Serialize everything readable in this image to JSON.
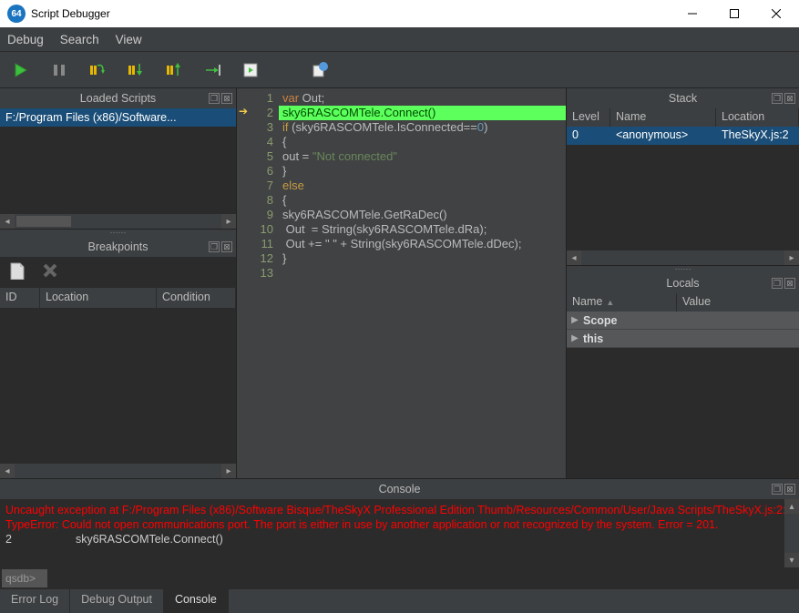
{
  "window": {
    "title": "Script Debugger",
    "icon_label": "64"
  },
  "menubar": [
    "Debug",
    "Search",
    "View"
  ],
  "toolbar": {
    "play": "play-icon",
    "pause": "pause-icon",
    "stepover": "step-over-icon",
    "stepinto": "step-into-icon",
    "stepout": "step-out-icon",
    "runcursor": "run-to-cursor-icon",
    "restart": "restart-icon",
    "module": "module-icon"
  },
  "loaded_scripts": {
    "title": "Loaded Scripts",
    "items": [
      "F:/Program Files (x86)/Software..."
    ]
  },
  "breakpoints": {
    "title": "Breakpoints",
    "headers": {
      "id": "ID",
      "location": "Location",
      "condition": "Condition"
    }
  },
  "editor": {
    "lines": [
      {
        "n": "1",
        "html": "<span class='kw'>var</span><span class='pl'> Out;</span>"
      },
      {
        "n": "2",
        "html": "<span class='hl-line'>sky6RASCOMTele.Connect()</span>"
      },
      {
        "n": "3",
        "html": "<span class='kw2'>if</span><span class='pl'> (sky6RASCOMTele.IsConnected==</span><span class='num'>0</span><span class='pl'>)</span>"
      },
      {
        "n": "4",
        "html": "<span class='pl'>{</span>"
      },
      {
        "n": "5",
        "html": "<span class='pl'>out = </span><span class='str'>\"Not connected\"</span>"
      },
      {
        "n": "6",
        "html": "<span class='pl'>}</span>"
      },
      {
        "n": "7",
        "html": "<span class='kw2'>else</span>"
      },
      {
        "n": "8",
        "html": "<span class='pl'>{</span>"
      },
      {
        "n": "9",
        "html": "<span class='pl'>sky6RASCOMTele.GetRaDec()</span>"
      },
      {
        "n": "10",
        "html": "<span class='pl'> Out  = String(sky6RASCOMTele.dRa);</span>"
      },
      {
        "n": "11",
        "html": "<span class='pl'> Out += \" \" + String(sky6RASCOMTele.dDec);</span>"
      },
      {
        "n": "12",
        "html": "<span class='pl'>}</span>"
      },
      {
        "n": "13",
        "html": ""
      }
    ],
    "current_line": 2
  },
  "stack": {
    "title": "Stack",
    "headers": {
      "level": "Level",
      "name": "Name",
      "location": "Location"
    },
    "rows": [
      {
        "level": "0",
        "name": "<anonymous>",
        "location": "TheSkyX.js:2"
      }
    ]
  },
  "locals": {
    "title": "Locals",
    "headers": {
      "name": "Name",
      "value": "Value"
    },
    "rows": [
      {
        "label": "Scope"
      },
      {
        "label": "this"
      }
    ]
  },
  "console": {
    "title": "Console",
    "error": "Uncaught exception at F:/Program Files (x86)/Software Bisque/TheSkyX Professional Edition Thumb/Resources/Common/User/Java Scripts/TheSkyX.js:2: TypeError: Could not open communications port.  The port is either in use by another application or not recognized by the system. Error = 201.",
    "line_no": "2",
    "line_text": "sky6RASCOMTele.Connect()",
    "prompt": "qsdb>",
    "tabs": [
      "Error Log",
      "Debug Output",
      "Console"
    ],
    "active_tab": 2
  }
}
